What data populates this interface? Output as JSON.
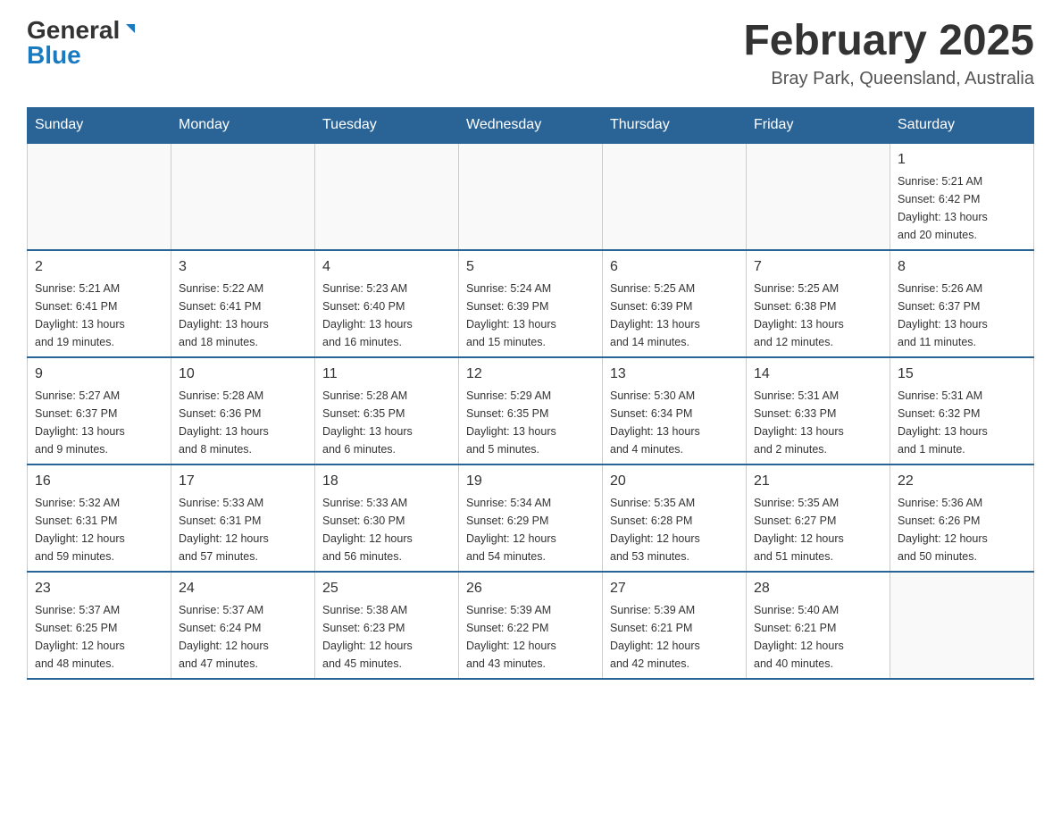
{
  "header": {
    "logo_general": "General",
    "logo_blue": "Blue",
    "month_title": "February 2025",
    "location": "Bray Park, Queensland, Australia"
  },
  "weekdays": [
    "Sunday",
    "Monday",
    "Tuesday",
    "Wednesday",
    "Thursday",
    "Friday",
    "Saturday"
  ],
  "weeks": [
    {
      "days": [
        {
          "num": "",
          "info": ""
        },
        {
          "num": "",
          "info": ""
        },
        {
          "num": "",
          "info": ""
        },
        {
          "num": "",
          "info": ""
        },
        {
          "num": "",
          "info": ""
        },
        {
          "num": "",
          "info": ""
        },
        {
          "num": "1",
          "info": "Sunrise: 5:21 AM\nSunset: 6:42 PM\nDaylight: 13 hours\nand 20 minutes."
        }
      ]
    },
    {
      "days": [
        {
          "num": "2",
          "info": "Sunrise: 5:21 AM\nSunset: 6:41 PM\nDaylight: 13 hours\nand 19 minutes."
        },
        {
          "num": "3",
          "info": "Sunrise: 5:22 AM\nSunset: 6:41 PM\nDaylight: 13 hours\nand 18 minutes."
        },
        {
          "num": "4",
          "info": "Sunrise: 5:23 AM\nSunset: 6:40 PM\nDaylight: 13 hours\nand 16 minutes."
        },
        {
          "num": "5",
          "info": "Sunrise: 5:24 AM\nSunset: 6:39 PM\nDaylight: 13 hours\nand 15 minutes."
        },
        {
          "num": "6",
          "info": "Sunrise: 5:25 AM\nSunset: 6:39 PM\nDaylight: 13 hours\nand 14 minutes."
        },
        {
          "num": "7",
          "info": "Sunrise: 5:25 AM\nSunset: 6:38 PM\nDaylight: 13 hours\nand 12 minutes."
        },
        {
          "num": "8",
          "info": "Sunrise: 5:26 AM\nSunset: 6:37 PM\nDaylight: 13 hours\nand 11 minutes."
        }
      ]
    },
    {
      "days": [
        {
          "num": "9",
          "info": "Sunrise: 5:27 AM\nSunset: 6:37 PM\nDaylight: 13 hours\nand 9 minutes."
        },
        {
          "num": "10",
          "info": "Sunrise: 5:28 AM\nSunset: 6:36 PM\nDaylight: 13 hours\nand 8 minutes."
        },
        {
          "num": "11",
          "info": "Sunrise: 5:28 AM\nSunset: 6:35 PM\nDaylight: 13 hours\nand 6 minutes."
        },
        {
          "num": "12",
          "info": "Sunrise: 5:29 AM\nSunset: 6:35 PM\nDaylight: 13 hours\nand 5 minutes."
        },
        {
          "num": "13",
          "info": "Sunrise: 5:30 AM\nSunset: 6:34 PM\nDaylight: 13 hours\nand 4 minutes."
        },
        {
          "num": "14",
          "info": "Sunrise: 5:31 AM\nSunset: 6:33 PM\nDaylight: 13 hours\nand 2 minutes."
        },
        {
          "num": "15",
          "info": "Sunrise: 5:31 AM\nSunset: 6:32 PM\nDaylight: 13 hours\nand 1 minute."
        }
      ]
    },
    {
      "days": [
        {
          "num": "16",
          "info": "Sunrise: 5:32 AM\nSunset: 6:31 PM\nDaylight: 12 hours\nand 59 minutes."
        },
        {
          "num": "17",
          "info": "Sunrise: 5:33 AM\nSunset: 6:31 PM\nDaylight: 12 hours\nand 57 minutes."
        },
        {
          "num": "18",
          "info": "Sunrise: 5:33 AM\nSunset: 6:30 PM\nDaylight: 12 hours\nand 56 minutes."
        },
        {
          "num": "19",
          "info": "Sunrise: 5:34 AM\nSunset: 6:29 PM\nDaylight: 12 hours\nand 54 minutes."
        },
        {
          "num": "20",
          "info": "Sunrise: 5:35 AM\nSunset: 6:28 PM\nDaylight: 12 hours\nand 53 minutes."
        },
        {
          "num": "21",
          "info": "Sunrise: 5:35 AM\nSunset: 6:27 PM\nDaylight: 12 hours\nand 51 minutes."
        },
        {
          "num": "22",
          "info": "Sunrise: 5:36 AM\nSunset: 6:26 PM\nDaylight: 12 hours\nand 50 minutes."
        }
      ]
    },
    {
      "days": [
        {
          "num": "23",
          "info": "Sunrise: 5:37 AM\nSunset: 6:25 PM\nDaylight: 12 hours\nand 48 minutes."
        },
        {
          "num": "24",
          "info": "Sunrise: 5:37 AM\nSunset: 6:24 PM\nDaylight: 12 hours\nand 47 minutes."
        },
        {
          "num": "25",
          "info": "Sunrise: 5:38 AM\nSunset: 6:23 PM\nDaylight: 12 hours\nand 45 minutes."
        },
        {
          "num": "26",
          "info": "Sunrise: 5:39 AM\nSunset: 6:22 PM\nDaylight: 12 hours\nand 43 minutes."
        },
        {
          "num": "27",
          "info": "Sunrise: 5:39 AM\nSunset: 6:21 PM\nDaylight: 12 hours\nand 42 minutes."
        },
        {
          "num": "28",
          "info": "Sunrise: 5:40 AM\nSunset: 6:21 PM\nDaylight: 12 hours\nand 40 minutes."
        },
        {
          "num": "",
          "info": ""
        }
      ]
    }
  ]
}
